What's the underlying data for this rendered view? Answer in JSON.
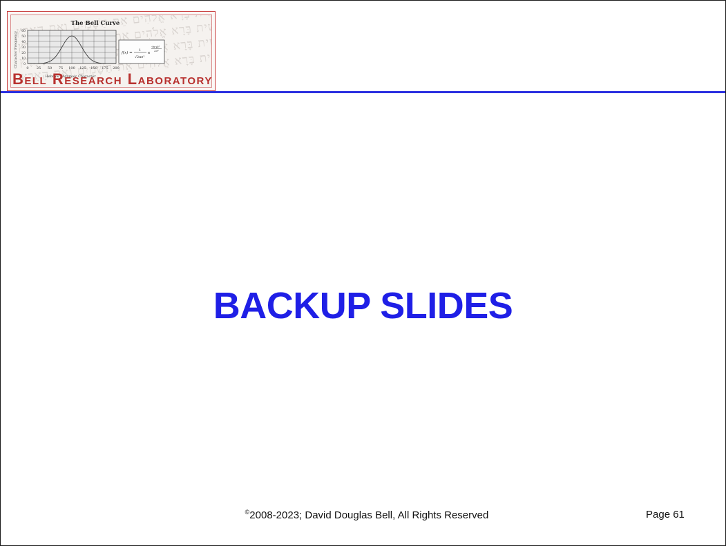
{
  "logo": {
    "chart_title": "The Bell Curve",
    "ylabel": "Character Frequency",
    "xlabel": "Hebrew / Aramaic Character",
    "x_ticks": [
      "0",
      "25",
      "50",
      "75",
      "100",
      "125",
      "150",
      "175",
      "200"
    ],
    "y_ticks": [
      "60",
      "50",
      "40",
      "30",
      "20",
      "10",
      "0"
    ],
    "formula": "f(x) = 1/√(2πσ²) e^(-(x-μ)²/2σ²)",
    "lab_name": "Bell Research Laboratory",
    "background_text": "בְּרֵאשִׁית בָּרָא אֱלֹהִים אֵת הַשָּׁמַיִם וְאֵת הָאָרֶץ"
  },
  "slide": {
    "title": "BACKUP SLIDES"
  },
  "footer": {
    "copyright_symbol": "©",
    "copyright_text": "2008-2023;  David Douglas Bell, All Rights Reserved",
    "page_label": "Page 61"
  },
  "colors": {
    "title": "#1f1fe6",
    "rule": "#2a2fe0",
    "logo_border": "#c83c3c",
    "lab_name": "#b8312f"
  }
}
